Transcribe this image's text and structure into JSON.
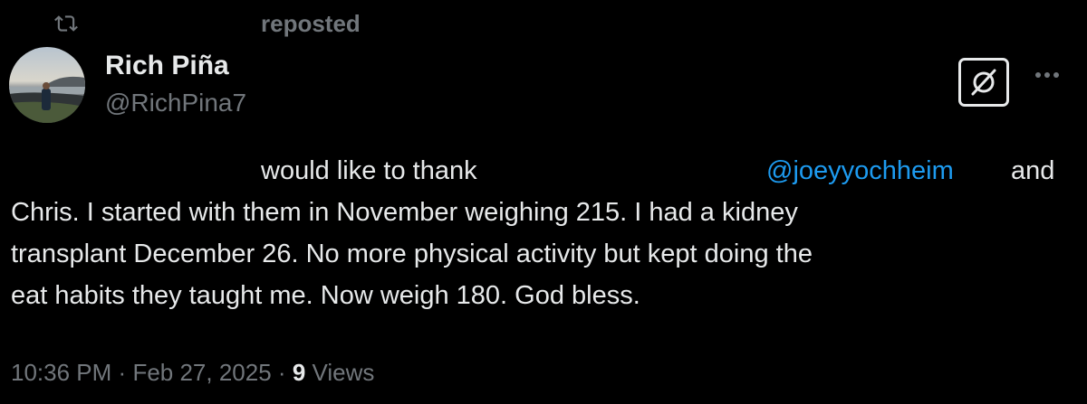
{
  "repost": {
    "label": "reposted",
    "icon": "repost-icon"
  },
  "author": {
    "name": "Rich Piña",
    "handle": "@RichPina7",
    "avatar": "avatar-photo"
  },
  "header_actions": {
    "grok_icon": "grok-icon",
    "more_icon": "more-icon"
  },
  "tweet": {
    "line1_text_a": "would like to thank",
    "line1_mention": "@joeyyochheim",
    "line1_text_b": "and",
    "line2": "Chris. I started with them in November weighing 215. I had a kidney",
    "line3": "transplant December 26. No more physical activity but kept doing the",
    "line4": "eat habits they taught me. Now weigh 180. God bless."
  },
  "meta": {
    "time": "10:36 PM",
    "separator": "·",
    "date": "Feb 27, 2025",
    "views_count": "9",
    "views_label": "Views"
  },
  "colors": {
    "background": "#000000",
    "text_primary": "#e7e9ea",
    "text_secondary": "#71767b",
    "link": "#1d9bf0"
  }
}
